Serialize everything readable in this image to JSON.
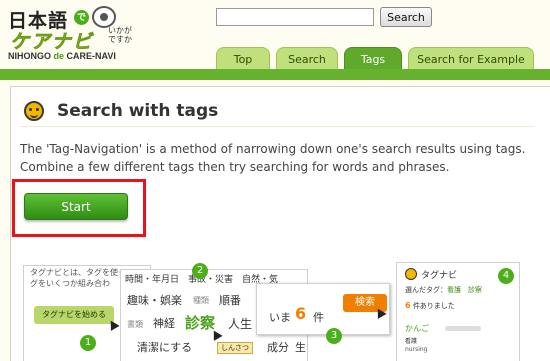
{
  "logo": {
    "top": "日本語",
    "de": "で",
    "mid": "ケアナビ",
    "side": "いかが\nですか",
    "bottom_prefix": "NIHONGO ",
    "bottom_de": "de",
    "bottom_suffix": " CARE-NAVI"
  },
  "search": {
    "value": "",
    "button_label": "Search"
  },
  "tabs": [
    {
      "label": "Top"
    },
    {
      "label": "Search"
    },
    {
      "label": "Tags"
    },
    {
      "label": "Search for Example"
    }
  ],
  "page": {
    "title": "Search with tags",
    "description": "The 'Tag-Navigation' is a method of narrowing down one's search results using tags. Combine a few different tags then try searching for words and phrases.",
    "start_label": "Start"
  },
  "previews": {
    "step1": {
      "text1": "タグナビとは、タグを使っ",
      "text2": "グをいくつか組み合わ",
      "button": "タグナビを始める",
      "number": "1"
    },
    "step2": {
      "row1": "時間・年月日　事故・災害　自然・気",
      "row2a": "趣味・娯楽",
      "row2b": "種類",
      "row2c": "順番",
      "row3a": "書類",
      "row3b": "神経",
      "row3c": "診察",
      "row3d": "人生",
      "row4a": "清潔にする",
      "row4b": "成分",
      "row4c": "生",
      "tooltip": "しんさつ",
      "number": "2"
    },
    "step3": {
      "label": "いま",
      "count": "6",
      "unit": "件",
      "button": "検索",
      "number": "3"
    },
    "step4": {
      "title": "タグナビ",
      "selected_label": "選んだタグ：",
      "selected_tags": "看護　診察",
      "count": "6",
      "count_suffix": "件ありました",
      "word": "かんご",
      "kanji": "看護",
      "romaji": "nursing",
      "number": "4"
    }
  }
}
